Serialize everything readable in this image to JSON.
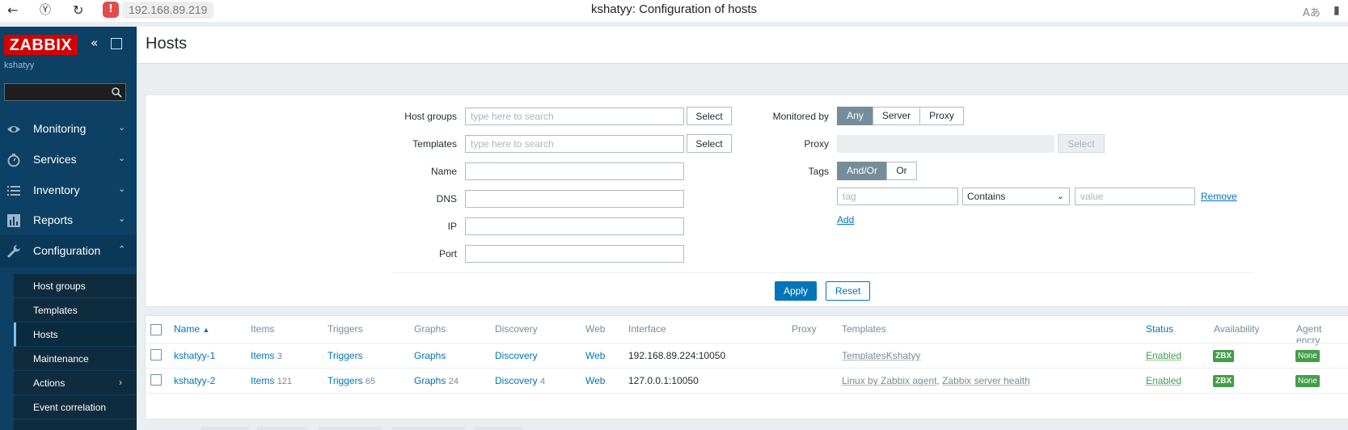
{
  "browser": {
    "url": "192.168.89.219",
    "title": "kshatyy: Configuration of hosts"
  },
  "sidebar": {
    "logo": "ZABBIX",
    "user": "kshatyy",
    "search_value": "",
    "menu": [
      {
        "label": "Monitoring",
        "icon": "eye-icon"
      },
      {
        "label": "Services",
        "icon": "stopwatch-icon"
      },
      {
        "label": "Inventory",
        "icon": "list-icon"
      },
      {
        "label": "Reports",
        "icon": "bar-chart-icon"
      },
      {
        "label": "Configuration",
        "icon": "wrench-icon"
      }
    ],
    "submenu": [
      {
        "label": "Host groups"
      },
      {
        "label": "Templates"
      },
      {
        "label": "Hosts",
        "active": true
      },
      {
        "label": "Maintenance"
      },
      {
        "label": "Actions"
      },
      {
        "label": "Event correlation"
      }
    ]
  },
  "header": {
    "title": "Hosts"
  },
  "filter": {
    "host_groups_label": "Host groups",
    "templates_label": "Templates",
    "name_label": "Name",
    "dns_label": "DNS",
    "ip_label": "IP",
    "port_label": "Port",
    "search_placeholder": "type here to search",
    "select_label": "Select",
    "monitored_by_label": "Monitored by",
    "monitored_by_options": [
      "Any",
      "Server",
      "Proxy"
    ],
    "proxy_label": "Proxy",
    "tags_label": "Tags",
    "tags_options": [
      "And/Or",
      "Or"
    ],
    "tag_placeholder": "tag",
    "operator_value": "Contains",
    "value_placeholder": "value",
    "remove_label": "Remove",
    "add_label": "Add",
    "apply_label": "Apply",
    "reset_label": "Reset"
  },
  "table": {
    "columns": [
      "Name",
      "Items",
      "Triggers",
      "Graphs",
      "Discovery",
      "Web",
      "Interface",
      "Proxy",
      "Templates",
      "Status",
      "Availability",
      "Agent encry"
    ],
    "sort_indicator": "▲",
    "rows": [
      {
        "name": "kshatyy-1",
        "items": "Items",
        "items_count": "3",
        "triggers": "Triggers",
        "triggers_count": "",
        "graphs": "Graphs",
        "graphs_count": "",
        "discovery": "Discovery",
        "discovery_count": "",
        "web": "Web",
        "interface": "192.168.89.224:10050",
        "proxy": "",
        "templates": [
          "TemplatesKshatyy"
        ],
        "status": "Enabled",
        "availability": "ZBX",
        "encryption": "None"
      },
      {
        "name": "kshatyy-2",
        "items": "Items",
        "items_count": "121",
        "triggers": "Triggers",
        "triggers_count": "65",
        "graphs": "Graphs",
        "graphs_count": "24",
        "discovery": "Discovery",
        "discovery_count": "4",
        "web": "Web",
        "interface": "127.0.0.1:10050",
        "proxy": "",
        "templates": [
          "Linux by Zabbix agent",
          "Zabbix server health"
        ],
        "template_separator": ", ",
        "status": "Enabled",
        "availability": "ZBX",
        "encryption": "None"
      }
    ]
  },
  "colors": {
    "sidebar_bg": "#0c4064",
    "accent": "#0275b8",
    "logo_red": "#d40000",
    "status_green": "#429e47"
  }
}
